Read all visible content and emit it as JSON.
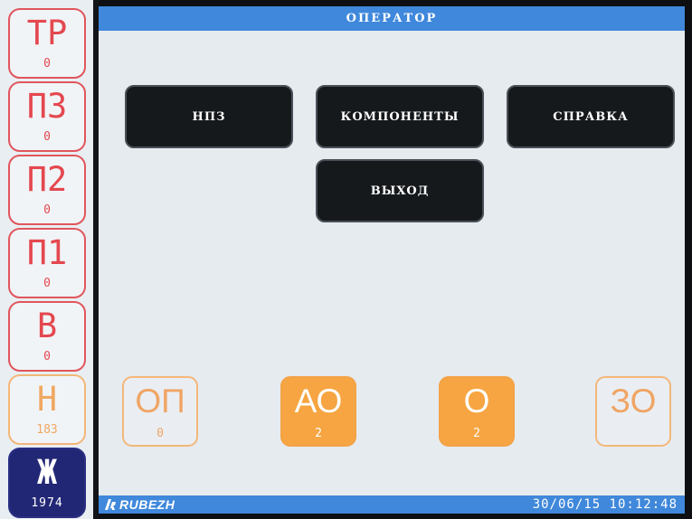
{
  "header": {
    "title": "ОПЕРАТОР"
  },
  "sidebar": {
    "items": [
      {
        "code": "ТР",
        "count": "0"
      },
      {
        "code": "ПЗ",
        "count": "0"
      },
      {
        "code": "П2",
        "count": "0"
      },
      {
        "code": "П1",
        "count": "0"
      },
      {
        "code": "В",
        "count": "0"
      },
      {
        "code": "Н",
        "count": "183"
      },
      {
        "code": "Ж",
        "count": "1974"
      }
    ]
  },
  "menu": {
    "npz": "НПЗ",
    "components": "КОМПОНЕНТЫ",
    "help": "СПРАВКА",
    "exit": "ВЫХОД"
  },
  "states": [
    {
      "code": "ОП",
      "count": "0"
    },
    {
      "code": "АО",
      "count": "2"
    },
    {
      "code": "О",
      "count": "2"
    },
    {
      "code": "ЗО",
      "count": ""
    }
  ],
  "footer": {
    "brand": "RUBEZH",
    "datetime": "30/06/15 10:12:48"
  },
  "colors": {
    "alarm_red": "#e4484f",
    "warning_orange": "#f6a542",
    "navy": "#222775",
    "title_blue": "#3f88db",
    "menu_black": "#16191c"
  },
  "icons": {
    "logo": "rubezh-logo-icon"
  }
}
